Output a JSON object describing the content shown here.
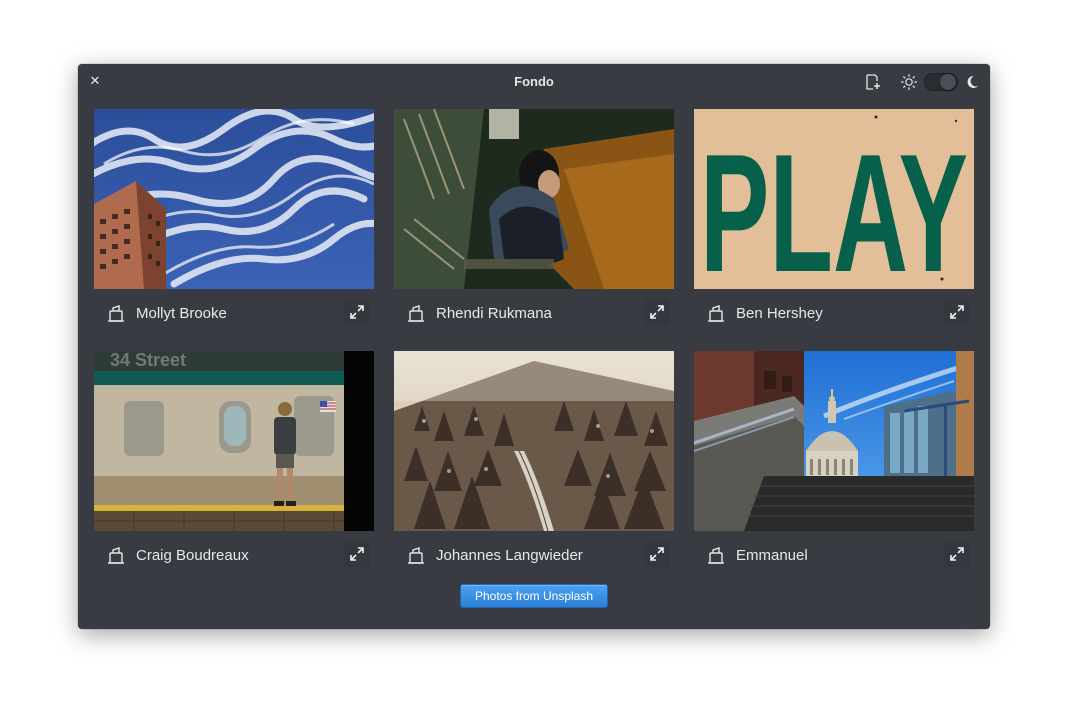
{
  "window": {
    "title": "Fondo",
    "close_icon": "close-icon",
    "add_folder_icon": "add-folder-icon",
    "theme_light_icon": "sun-icon",
    "theme_dark_icon": "moon-icon",
    "dark_mode_enabled": true
  },
  "photos": [
    {
      "author": "Mollyt Brooke",
      "subject": "clouds-and-building"
    },
    {
      "author": "Rhendi Rukmana",
      "subject": "woman-sitting"
    },
    {
      "author": "Ben Hershey",
      "subject": "play-sign"
    },
    {
      "author": "Craig Boudreaux",
      "subject": "subway-34-street"
    },
    {
      "author": "Johannes Langwieder",
      "subject": "snowy-forest"
    },
    {
      "author": "Emmanuel",
      "subject": "st-pauls-dome"
    }
  ],
  "photo_texts": {
    "play_sign": "PLAY",
    "subway_sign": "34 Street"
  },
  "footer": {
    "unsplash_button": "Photos from Unsplash"
  },
  "colors": {
    "window_bg": "#383b42",
    "accent": "#3689e6",
    "text": "#e8e8e8"
  }
}
